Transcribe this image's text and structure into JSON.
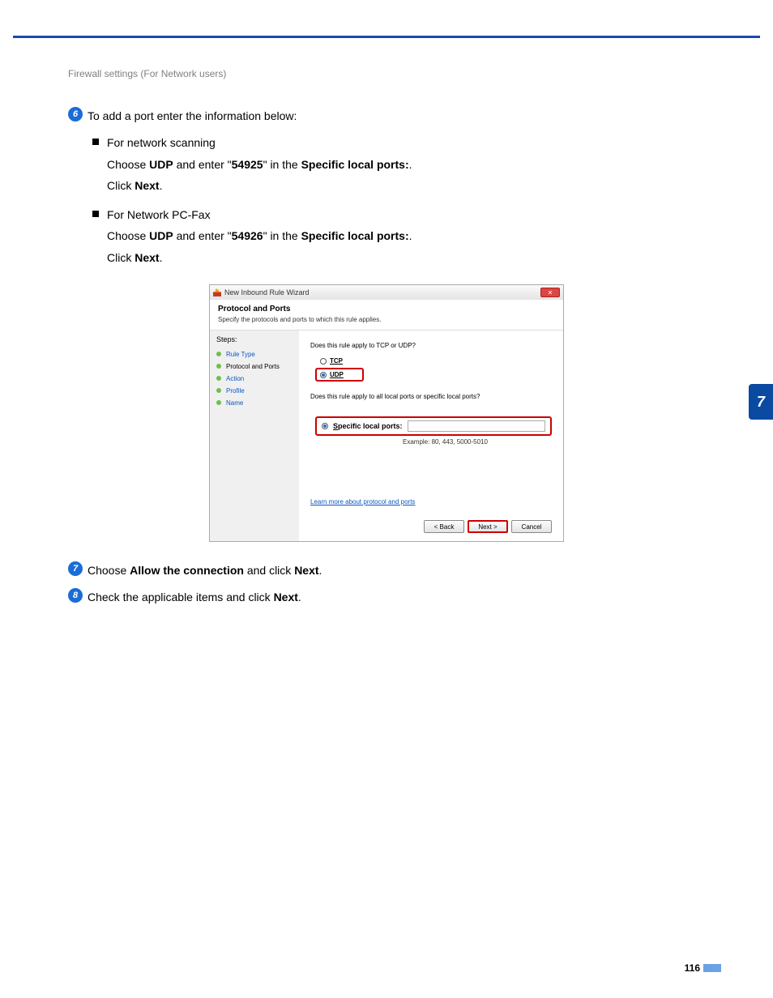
{
  "header": {
    "crumb": "Firewall settings (For Network users)"
  },
  "side_tab": "7",
  "page_number": "116",
  "steps": {
    "s6": {
      "num": "6",
      "badge_name": "step-badge-6",
      "intro": "To add a port enter the information below:",
      "bullets": [
        {
          "title": "For network scanning",
          "line1_pre": "Choose ",
          "line1_b1": "UDP",
          "line1_mid": " and enter \"",
          "line1_b2": "54925",
          "line1_mid2": "\" in the ",
          "line1_b3": "Specific local ports:",
          "line1_post": ".",
          "line2_pre": "Click ",
          "line2_b": "Next",
          "line2_post": "."
        },
        {
          "title": "For Network PC-Fax",
          "line1_pre": "Choose ",
          "line1_b1": "UDP",
          "line1_mid": " and enter \"",
          "line1_b2": "54926",
          "line1_mid2": "\" in the ",
          "line1_b3": "Specific local ports:",
          "line1_post": ".",
          "line2_pre": "Click ",
          "line2_b": "Next",
          "line2_post": "."
        }
      ]
    },
    "s7": {
      "num": "7",
      "badge_name": "step-badge-7",
      "pre": "Choose ",
      "b1": "Allow the connection",
      "mid": " and click ",
      "b2": "Next",
      "post": "."
    },
    "s8": {
      "num": "8",
      "badge_name": "step-badge-8",
      "pre": "Check the applicable items and click ",
      "b1": "Next",
      "post": "."
    }
  },
  "wizard": {
    "title": "New Inbound Rule Wizard",
    "heading": "Protocol and Ports",
    "subheading": "Specify the protocols and ports to which this rule applies.",
    "steps_label": "Steps:",
    "side": [
      {
        "label": "Rule Type"
      },
      {
        "label": "Protocol and Ports"
      },
      {
        "label": "Action"
      },
      {
        "label": "Profile"
      },
      {
        "label": "Name"
      }
    ],
    "q1": "Does this rule apply to TCP or UDP?",
    "tcp": "TCP",
    "udp": "UDP",
    "q2": "Does this rule apply to all local ports or specific local ports?",
    "specific": "Specific local ports:",
    "example": "Example: 80, 443, 5000-5010",
    "link": "Learn more about protocol and ports",
    "btn_back": "< Back",
    "btn_next": "Next >",
    "btn_cancel": "Cancel"
  }
}
